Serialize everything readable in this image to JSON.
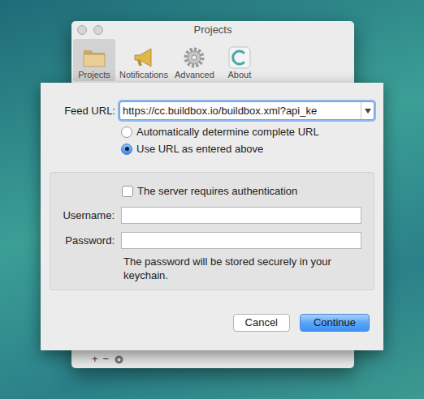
{
  "window": {
    "title": "Projects"
  },
  "toolbar": [
    {
      "label": "Projects",
      "selected": true
    },
    {
      "label": "Notifications",
      "selected": false
    },
    {
      "label": "Advanced",
      "selected": false
    },
    {
      "label": "About",
      "selected": false
    }
  ],
  "sheet": {
    "feed_url": {
      "label": "Feed URL:",
      "value": "https://cc.buildbox.io/buildbox.xml?api_ke"
    },
    "url_options": [
      {
        "label": "Automatically determine complete URL",
        "selected": false
      },
      {
        "label": "Use URL as entered above",
        "selected": true
      }
    ],
    "auth": {
      "label": "The server requires authentication",
      "checked": false
    },
    "username": {
      "label": "Username:",
      "value": ""
    },
    "password": {
      "label": "Password:",
      "value": ""
    },
    "note": "The password will be stored securely in your keychain.",
    "buttons": [
      {
        "label": "Cancel",
        "default": false
      },
      {
        "label": "Continue",
        "default": true
      }
    ]
  },
  "list_controls": [
    "+",
    "−"
  ]
}
